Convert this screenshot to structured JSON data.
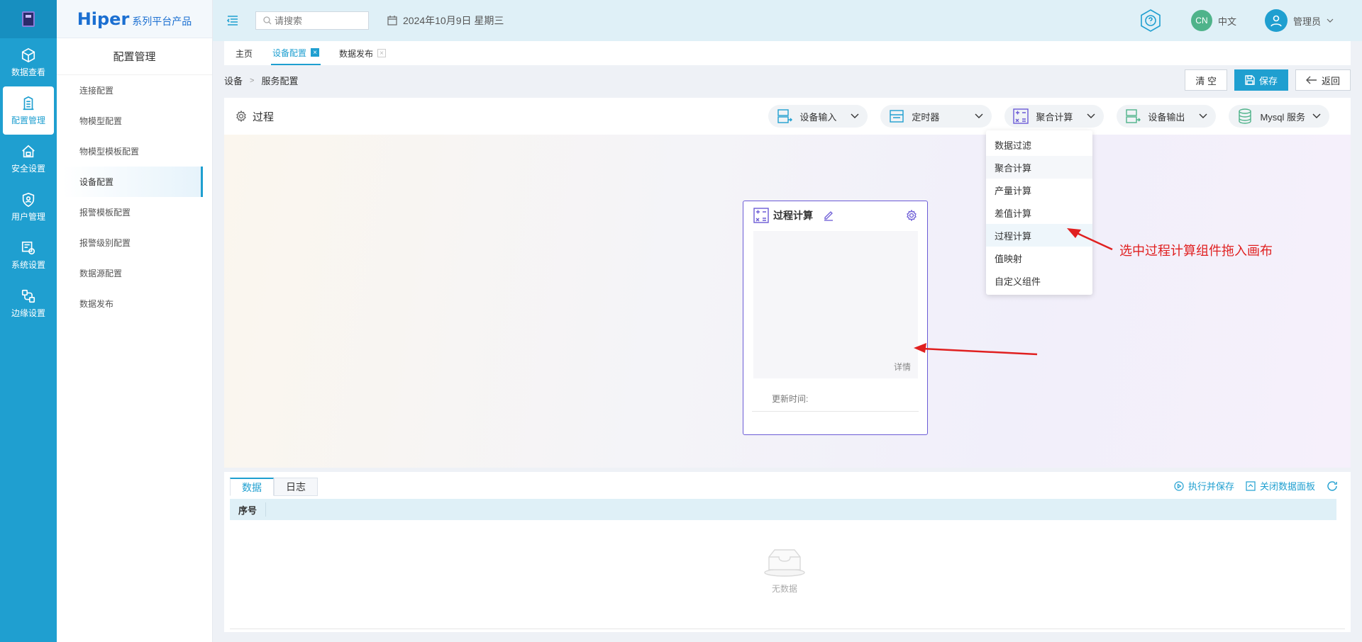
{
  "rail": {
    "items": [
      {
        "label": "数据查看",
        "icon": "cube-icon"
      },
      {
        "label": "配置管理",
        "icon": "building-icon"
      },
      {
        "label": "安全设置",
        "icon": "house-lock-icon"
      },
      {
        "label": "用户管理",
        "icon": "shield-user-icon"
      },
      {
        "label": "系统设置",
        "icon": "system-gear-icon"
      },
      {
        "label": "边缘设置",
        "icon": "edge-nodes-icon"
      }
    ],
    "active_index": 1
  },
  "brand": {
    "big": "Hiper",
    "small": "系列平台产品"
  },
  "sidebar": {
    "title": "配置管理",
    "items": [
      {
        "label": "连接配置"
      },
      {
        "label": "物模型配置"
      },
      {
        "label": "物模型模板配置"
      },
      {
        "label": "设备配置"
      },
      {
        "label": "报警模板配置"
      },
      {
        "label": "报警级别配置"
      },
      {
        "label": "数据源配置"
      },
      {
        "label": "数据发布"
      }
    ],
    "active_index": 3
  },
  "topbar": {
    "search_placeholder": "请搜索",
    "date": "2024年10月9日 星期三",
    "lang_badge": "CN",
    "lang_label": "中文",
    "user_label": "管理员"
  },
  "tabs": [
    {
      "label": "主页"
    },
    {
      "label": "设备配置"
    },
    {
      "label": "数据发布"
    }
  ],
  "breadcrumb": {
    "root": "设备",
    "sep": ">",
    "current": "服务配置"
  },
  "actions": {
    "clear": "清 空",
    "save": "保存",
    "back": "返回"
  },
  "process": {
    "title": "过程",
    "pills": [
      {
        "label": "设备输入"
      },
      {
        "label": "定时器"
      },
      {
        "label": "聚合计算"
      },
      {
        "label": "设备输出"
      },
      {
        "label": "Mysql 服务"
      }
    ]
  },
  "dropdown": {
    "items": [
      {
        "label": "数据过滤"
      },
      {
        "label": "聚合计算"
      },
      {
        "label": "产量计算"
      },
      {
        "label": "差值计算"
      },
      {
        "label": "过程计算"
      },
      {
        "label": "值映射"
      },
      {
        "label": "自定义组件"
      }
    ]
  },
  "card": {
    "title": "过程计算",
    "detail": "详情",
    "updated": "更新时间:"
  },
  "annotation": "选中过程计算组件拖入画布",
  "panel": {
    "tabs": [
      {
        "label": "数据"
      },
      {
        "label": "日志"
      }
    ],
    "run_save": "执行并保存",
    "close_panel": "关闭数据面板",
    "column": "序号",
    "empty": "无数据"
  },
  "colors": {
    "primary": "#1f9fd0",
    "annotation": "#e02020",
    "node_border": "#6b5bd6"
  }
}
